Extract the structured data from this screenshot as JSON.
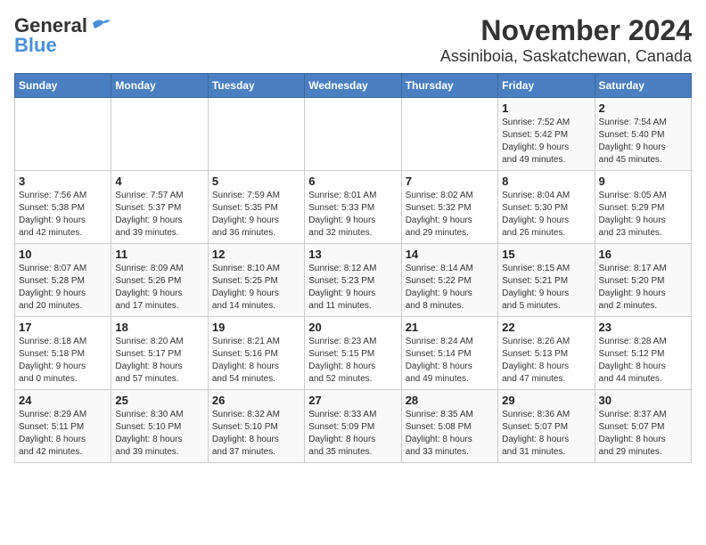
{
  "logo": {
    "line1": "General",
    "line2": "Blue"
  },
  "title": "November 2024",
  "subtitle": "Assiniboia, Saskatchewan, Canada",
  "weekdays": [
    "Sunday",
    "Monday",
    "Tuesday",
    "Wednesday",
    "Thursday",
    "Friday",
    "Saturday"
  ],
  "weeks": [
    [
      {
        "day": "",
        "info": ""
      },
      {
        "day": "",
        "info": ""
      },
      {
        "day": "",
        "info": ""
      },
      {
        "day": "",
        "info": ""
      },
      {
        "day": "",
        "info": ""
      },
      {
        "day": "1",
        "info": "Sunrise: 7:52 AM\nSunset: 5:42 PM\nDaylight: 9 hours\nand 49 minutes."
      },
      {
        "day": "2",
        "info": "Sunrise: 7:54 AM\nSunset: 5:40 PM\nDaylight: 9 hours\nand 45 minutes."
      }
    ],
    [
      {
        "day": "3",
        "info": "Sunrise: 7:56 AM\nSunset: 5:38 PM\nDaylight: 9 hours\nand 42 minutes."
      },
      {
        "day": "4",
        "info": "Sunrise: 7:57 AM\nSunset: 5:37 PM\nDaylight: 9 hours\nand 39 minutes."
      },
      {
        "day": "5",
        "info": "Sunrise: 7:59 AM\nSunset: 5:35 PM\nDaylight: 9 hours\nand 36 minutes."
      },
      {
        "day": "6",
        "info": "Sunrise: 8:01 AM\nSunset: 5:33 PM\nDaylight: 9 hours\nand 32 minutes."
      },
      {
        "day": "7",
        "info": "Sunrise: 8:02 AM\nSunset: 5:32 PM\nDaylight: 9 hours\nand 29 minutes."
      },
      {
        "day": "8",
        "info": "Sunrise: 8:04 AM\nSunset: 5:30 PM\nDaylight: 9 hours\nand 26 minutes."
      },
      {
        "day": "9",
        "info": "Sunrise: 8:05 AM\nSunset: 5:29 PM\nDaylight: 9 hours\nand 23 minutes."
      }
    ],
    [
      {
        "day": "10",
        "info": "Sunrise: 8:07 AM\nSunset: 5:28 PM\nDaylight: 9 hours\nand 20 minutes."
      },
      {
        "day": "11",
        "info": "Sunrise: 8:09 AM\nSunset: 5:26 PM\nDaylight: 9 hours\nand 17 minutes."
      },
      {
        "day": "12",
        "info": "Sunrise: 8:10 AM\nSunset: 5:25 PM\nDaylight: 9 hours\nand 14 minutes."
      },
      {
        "day": "13",
        "info": "Sunrise: 8:12 AM\nSunset: 5:23 PM\nDaylight: 9 hours\nand 11 minutes."
      },
      {
        "day": "14",
        "info": "Sunrise: 8:14 AM\nSunset: 5:22 PM\nDaylight: 9 hours\nand 8 minutes."
      },
      {
        "day": "15",
        "info": "Sunrise: 8:15 AM\nSunset: 5:21 PM\nDaylight: 9 hours\nand 5 minutes."
      },
      {
        "day": "16",
        "info": "Sunrise: 8:17 AM\nSunset: 5:20 PM\nDaylight: 9 hours\nand 2 minutes."
      }
    ],
    [
      {
        "day": "17",
        "info": "Sunrise: 8:18 AM\nSunset: 5:18 PM\nDaylight: 9 hours\nand 0 minutes."
      },
      {
        "day": "18",
        "info": "Sunrise: 8:20 AM\nSunset: 5:17 PM\nDaylight: 8 hours\nand 57 minutes."
      },
      {
        "day": "19",
        "info": "Sunrise: 8:21 AM\nSunset: 5:16 PM\nDaylight: 8 hours\nand 54 minutes."
      },
      {
        "day": "20",
        "info": "Sunrise: 8:23 AM\nSunset: 5:15 PM\nDaylight: 8 hours\nand 52 minutes."
      },
      {
        "day": "21",
        "info": "Sunrise: 8:24 AM\nSunset: 5:14 PM\nDaylight: 8 hours\nand 49 minutes."
      },
      {
        "day": "22",
        "info": "Sunrise: 8:26 AM\nSunset: 5:13 PM\nDaylight: 8 hours\nand 47 minutes."
      },
      {
        "day": "23",
        "info": "Sunrise: 8:28 AM\nSunset: 5:12 PM\nDaylight: 8 hours\nand 44 minutes."
      }
    ],
    [
      {
        "day": "24",
        "info": "Sunrise: 8:29 AM\nSunset: 5:11 PM\nDaylight: 8 hours\nand 42 minutes."
      },
      {
        "day": "25",
        "info": "Sunrise: 8:30 AM\nSunset: 5:10 PM\nDaylight: 8 hours\nand 39 minutes."
      },
      {
        "day": "26",
        "info": "Sunrise: 8:32 AM\nSunset: 5:10 PM\nDaylight: 8 hours\nand 37 minutes."
      },
      {
        "day": "27",
        "info": "Sunrise: 8:33 AM\nSunset: 5:09 PM\nDaylight: 8 hours\nand 35 minutes."
      },
      {
        "day": "28",
        "info": "Sunrise: 8:35 AM\nSunset: 5:08 PM\nDaylight: 8 hours\nand 33 minutes."
      },
      {
        "day": "29",
        "info": "Sunrise: 8:36 AM\nSunset: 5:07 PM\nDaylight: 8 hours\nand 31 minutes."
      },
      {
        "day": "30",
        "info": "Sunrise: 8:37 AM\nSunset: 5:07 PM\nDaylight: 8 hours\nand 29 minutes."
      }
    ]
  ]
}
